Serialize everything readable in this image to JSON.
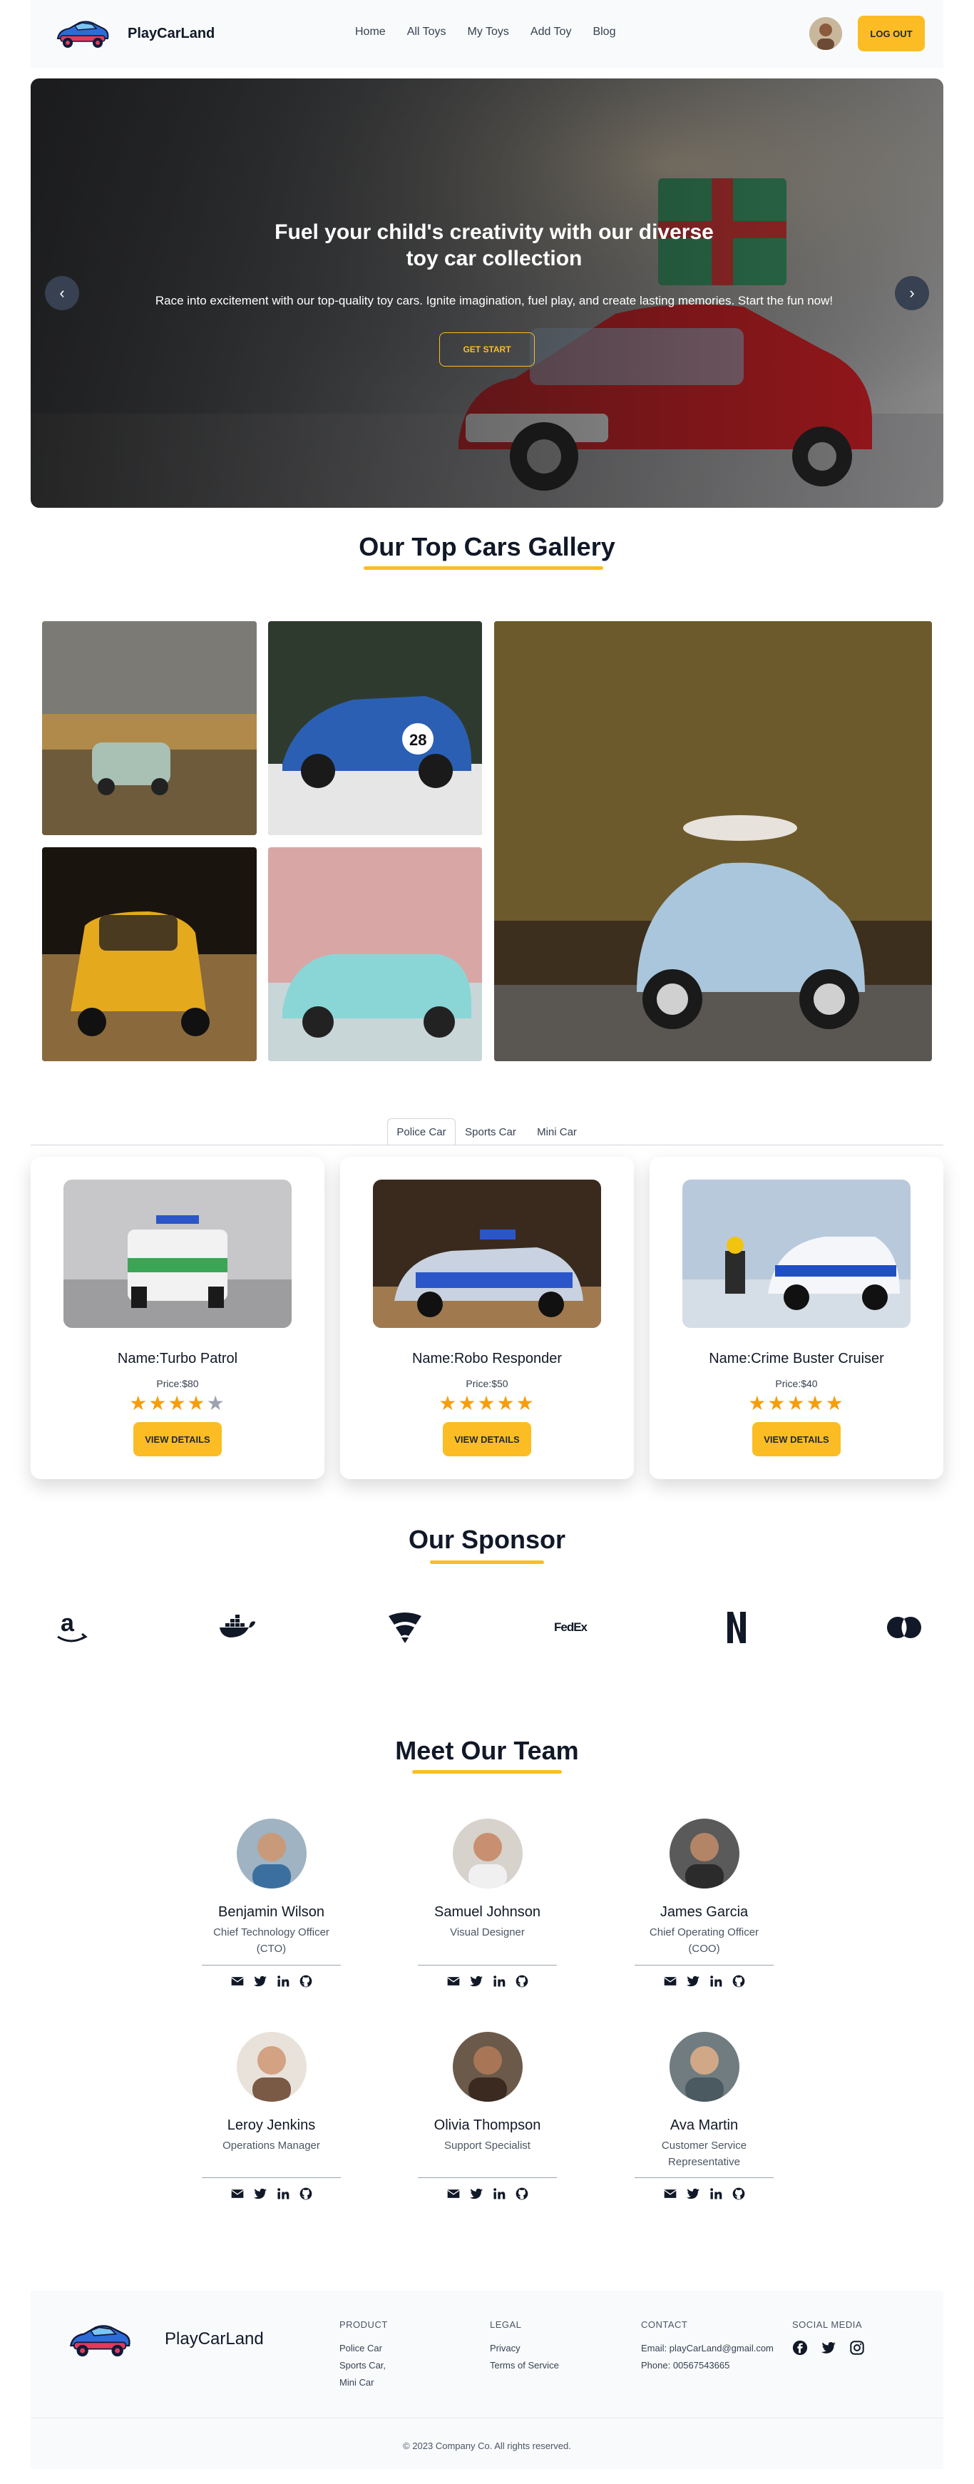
{
  "nav": {
    "brand": "PlayCarLand",
    "links": [
      "Home",
      "All Toys",
      "My Toys",
      "Add Toy",
      "Blog"
    ],
    "logout": "LOG OUT"
  },
  "hero": {
    "title": "Fuel your child's creativity with our diverse toy car collection",
    "subtitle": "Race into excitement with our top-quality toy cars. Ignite imagination, fuel play, and create lasting memories. Start the fun now!",
    "button": "GET START",
    "prev": "‹",
    "next": "›"
  },
  "gallery": {
    "title": "Our Top Cars Gallery"
  },
  "tabs": [
    "Police Car",
    "Sports Car",
    "Mini Car"
  ],
  "cards": [
    {
      "name": "Name:Turbo Patrol",
      "price": "Price:$80",
      "rating": 4,
      "button": "VIEW DETAILS"
    },
    {
      "name": "Name:Robo Responder",
      "price": "Price:$50",
      "rating": 5,
      "button": "VIEW DETAILS"
    },
    {
      "name": "Name:Crime Buster Cruiser",
      "price": "Price:$40",
      "rating": 5,
      "button": "VIEW DETAILS"
    }
  ],
  "sponsor": {
    "title": "Our Sponsor",
    "logos": [
      "amazon-logo",
      "docker-logo",
      "f-secure-logo",
      "fedex-logo",
      "netflix-logo",
      "mastercard-logo"
    ],
    "fedex_text": "FedEx"
  },
  "team": {
    "title": "Meet Our Team",
    "members": [
      {
        "name": "Benjamin Wilson",
        "role": "Chief Technology Officer (CTO)"
      },
      {
        "name": "Samuel Johnson",
        "role": "Visual Designer"
      },
      {
        "name": "James Garcia",
        "role": "Chief Operating Officer (COO)"
      },
      {
        "name": "Leroy Jenkins",
        "role": "Operations Manager"
      },
      {
        "name": "Olivia Thompson",
        "role": "Support Specialist"
      },
      {
        "name": "Ava Martin",
        "role": "Customer Service Representative"
      }
    ]
  },
  "footer": {
    "brand": "PlayCarLand",
    "product": {
      "heading": "PRODUCT",
      "items": [
        "Police Car",
        "Sports Car,",
        "Mini Car"
      ]
    },
    "legal": {
      "heading": "LEGAL",
      "items": [
        "Privacy",
        "Terms of Service"
      ]
    },
    "contact": {
      "heading": "CONTACT",
      "items": [
        "Email: playCarLand@gmail.com",
        "Phone: 00567543665"
      ]
    },
    "social": {
      "heading": "SOCIAL MEDIA"
    },
    "copyright": "© 2023 Company Co. All rights reserved."
  },
  "colors": {
    "accent": "#fbbd23",
    "star": "#f59e0b",
    "dark": "#111827",
    "footer_bg": "#f8fafc"
  }
}
